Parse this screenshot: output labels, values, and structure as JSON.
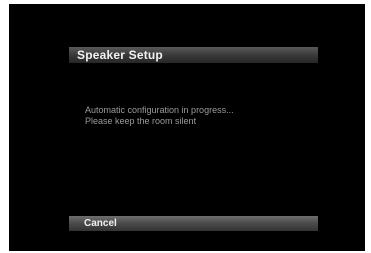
{
  "dialog": {
    "title": "Speaker Setup",
    "message_lines": [
      "Automatic configuration in progress...",
      "Please keep the room silent"
    ],
    "cancel_label": "Cancel"
  },
  "colors": {
    "screen_background": "#000000",
    "title_bar": "#3a3a3a",
    "cancel_bar": "#4a4a4a",
    "message_text": "#9a9a9a",
    "label_text": "#f2f2f2"
  }
}
